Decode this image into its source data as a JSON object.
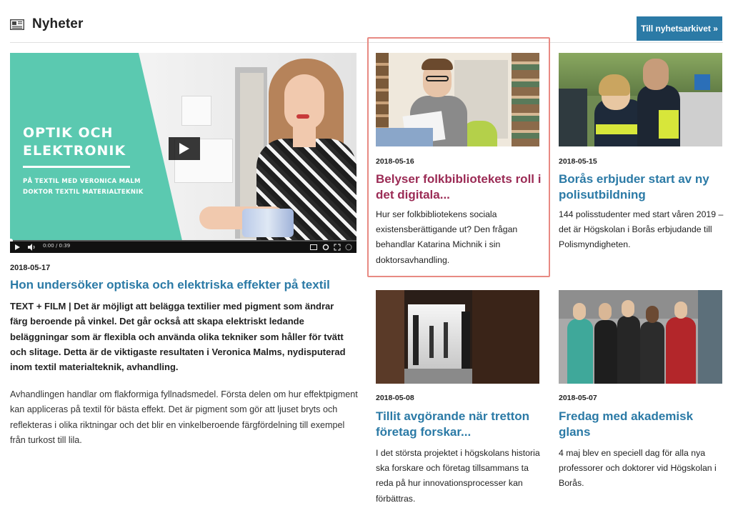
{
  "header": {
    "title": "Nyheter",
    "icon": "newspaper-icon",
    "archive_button": "Till nyhetsarkivet »"
  },
  "video": {
    "title_line1": "OPTIK OCH",
    "title_line2": "ELEKTRONIK",
    "subtitle_line1": "PÅ TEXTIL MED VERONICA MALM",
    "subtitle_line2": "DOKTOR TEXTIL MATERIALTEKNIK",
    "time": "0:00 / 0:39",
    "accent_color": "#5bc9b0"
  },
  "main_article": {
    "date": "2018-05-17",
    "title": "Hon undersöker optiska och elektriska effekter på textil",
    "lead": "TEXT + FILM | Det är möjligt att belägga textilier med pigment som ändrar färg beroende på vinkel. Det går också att skapa elektriskt ledande beläggningar som är flexibla och använda olika tekniker som håller för tvätt och slitage. Detta är de viktigaste resultaten i Veronica Malms, nydisputerad inom textil materialteknik, avhandling.",
    "body": "Avhandlingen handlar om flakformiga fyllnadsmedel. Första delen om hur effektpigment kan appliceras på textil för bästa effekt. Det är pigment som gör att ljuset bryts och reflekteras i olika riktningar och det blir en vinkelberoende färgfördelning till exempel från turkost till lila."
  },
  "cards": [
    {
      "date": "2018-05-16",
      "title": "Belyser folkbibliotekets roll i det digitala...",
      "text": "Hur ser folkbibliotekens sociala existensberättigande ut? Den frågan behandlar Katarina Michnik i sin doktorsavhandling.",
      "title_color": "#9b2b55"
    },
    {
      "date": "2018-05-15",
      "title": "Borås erbjuder start av ny polisutbildning",
      "text": "144 polisstudenter med start våren 2019 – det är Högskolan i Borås erbjudande till Polismyndigheten.",
      "title_color": "#2b7aa6"
    },
    {
      "date": "2018-05-08",
      "title": "Tillit avgörande när tretton företag forskar...",
      "text": "I det största projektet i högskolans historia ska forskare och företag tillsammans ta reda på hur innovationsprocesser kan förbättras.",
      "title_color": "#2b7aa6"
    },
    {
      "date": "2018-05-07",
      "title": "Fredag med akademisk glans",
      "text": "4 maj blev en speciell dag för alla nya professorer och doktorer vid Högskolan i Borås.",
      "title_color": "#2b7aa6"
    }
  ],
  "colors": {
    "link_blue": "#2b7aa6",
    "highlight_border": "#e88a83"
  }
}
